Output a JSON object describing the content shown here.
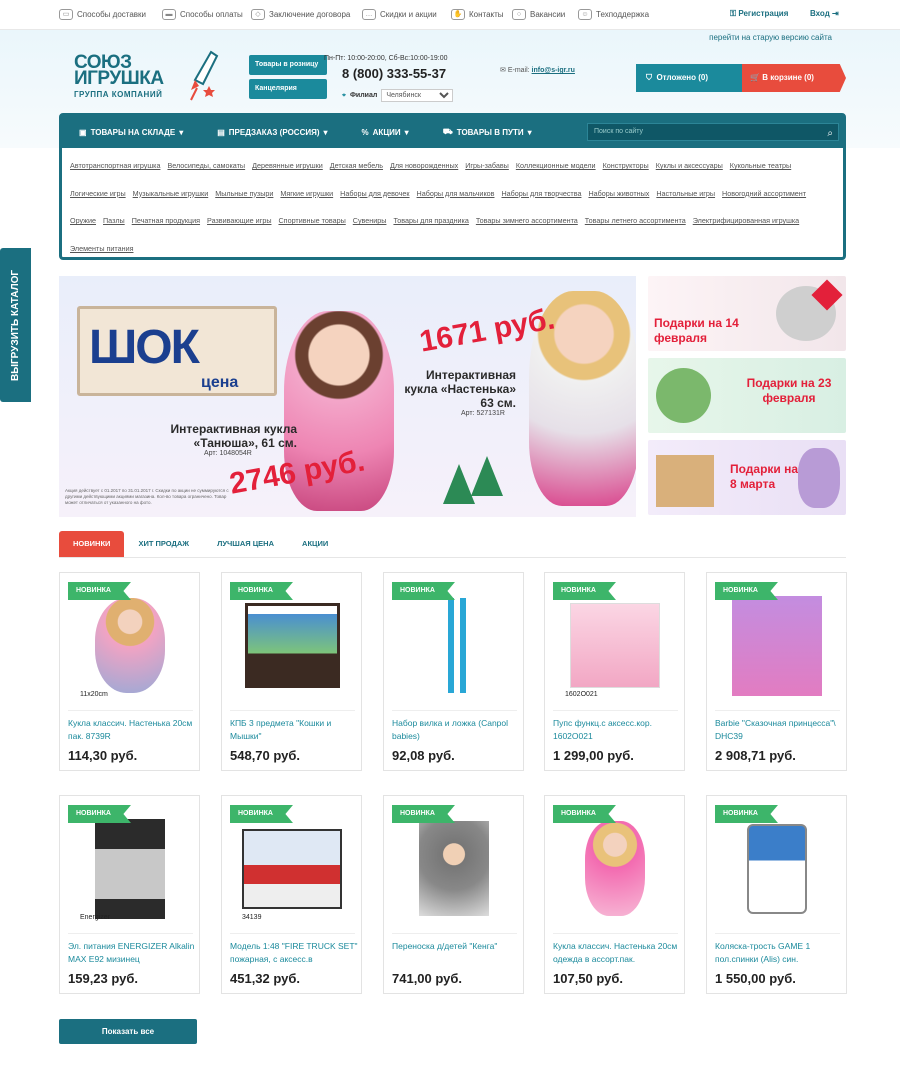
{
  "topbar": {
    "items": [
      "Способы доставки",
      "Способы оплаты",
      "Заключение договора",
      "Скидки и акции",
      "Контакты",
      "Вакансии",
      "Техподдержка"
    ],
    "register": "Регистрация",
    "login": "Вход"
  },
  "old_site": "перейти на старую версию сайта",
  "logo": {
    "line1": "СОЮЗ",
    "line2": "ИГРУШКА",
    "line3": "ГРУППА КОМПАНИЙ"
  },
  "header": {
    "retail_btn": "Товары в розницу",
    "stationery_btn": "Канцелярия",
    "hours": "Пн-Пт: 10:00-20:00, Сб-Вс:10:00-19:00",
    "phone": "8 (800) 333-55-37",
    "branch_label": "Филиал",
    "branch_value": "Челябинск",
    "email_label": "E-mail:",
    "email_value": "info@s-igr.ru",
    "deferred": "Отложено (0)",
    "cart": "В корзине (0)"
  },
  "nav": {
    "items": [
      "ТОВАРЫ НА СКЛАДЕ",
      "ПРЕДЗАКАЗ (РОССИЯ)",
      "АКЦИИ",
      "ТОВАРЫ В ПУТИ"
    ],
    "search_placeholder": "Поиск по сайту"
  },
  "categories": [
    "Автотранспортная игрушка",
    "Велосипеды, самокаты",
    "Деревянные игрушки",
    "Детская мебель",
    "Для новорожденных",
    "Игры-забавы",
    "Коллекционные модели",
    "Конструкторы",
    "Куклы и аксессуары",
    "Кукольные театры",
    "Логические игры",
    "Музыкальные игрушки",
    "Мыльные пузыри",
    "Мягкие игрушки",
    "Наборы для девочек",
    "Наборы для мальчиков",
    "Наборы для творчества",
    "Наборы животных",
    "Настольные игры",
    "Новогодний ассортимент",
    "Оружие",
    "Пазлы",
    "Печатная продукция",
    "Развивающие игры",
    "Спортивные товары",
    "Сувениры",
    "Товары для праздника",
    "Товары зимнего ассортимента",
    "Товары летнего ассортимента",
    "Электрифицированная игрушка",
    "Элементы питания"
  ],
  "side_tab": "ВЫГРУЗИТЬ КАТАЛОГ",
  "banner": {
    "shok": "ШОК",
    "cena": "цена",
    "doll1_title": "Интерактивная кукла «Танюша», 61 см.",
    "doll1_art": "Арт: 1048054R",
    "doll1_price": "2746 руб.",
    "doll2_title": "Интерактивная кукла «Настенька» 63 см.",
    "doll2_art": "Арт: 527131R",
    "doll2_price": "1671 руб.",
    "fine_print": "Акция действует с 01.2017 по 31.01.2017 г. Скидки по акции не суммируются с другими действующими акциями магазина. Кол-во товара ограничено. Товар может отличаться от указанного на фото."
  },
  "promos": [
    "Подарки на 14 февраля",
    "Подарки на 23 февраля",
    "Подарки на 8 марта"
  ],
  "tabs": [
    "НОВИНКИ",
    "ХИТ ПРОДАЖ",
    "ЛУЧШАЯ ЦЕНА",
    "АКЦИИ"
  ],
  "badge": "НОВИНКА",
  "products": [
    {
      "name": "Кукла классич. Настенька 20см пак. 8739R",
      "price": "114,30 руб.",
      "caption": "11x20cm"
    },
    {
      "name": "КПБ 3 предмета \"Кошки и Мышки\"",
      "price": "548,70 руб.",
      "caption": ""
    },
    {
      "name": "Набор вилка и ложка (Canpol babies)",
      "price": "92,08 руб.",
      "caption": ""
    },
    {
      "name": "Пупс функц.с аксесс.кор. 1602O021",
      "price": "1 299,00 руб.",
      "caption": "1602O021"
    },
    {
      "name": "Barbie \"Сказочная принцесса\"\\ DHC39",
      "price": "2 908,71 руб.",
      "caption": ""
    },
    {
      "name": "Эл. питания ENERGIZER Alkalin MAX E92 мизинец",
      "price": "159,23 руб.",
      "caption": "Energizer"
    },
    {
      "name": "Модель 1:48 \"FIRE TRUCK SET\" пожарная, с аксесс.в",
      "price": "451,32 руб.",
      "caption": "34139"
    },
    {
      "name": "Переноска д/детей \"Кенга\"",
      "price": "741,00 руб.",
      "caption": ""
    },
    {
      "name": "Кукла классич. Настенька 20см одежда в ассорт.пак.",
      "price": "107,50 руб.",
      "caption": ""
    },
    {
      "name": "Коляска-трость GAME 1 пол.спинки (Alis) син.",
      "price": "1 550,00 руб.",
      "caption": ""
    }
  ],
  "show_all": "Показать все",
  "colors": {
    "teal": "#1b6f80",
    "red": "#e84c3d",
    "green": "#3db56a"
  }
}
